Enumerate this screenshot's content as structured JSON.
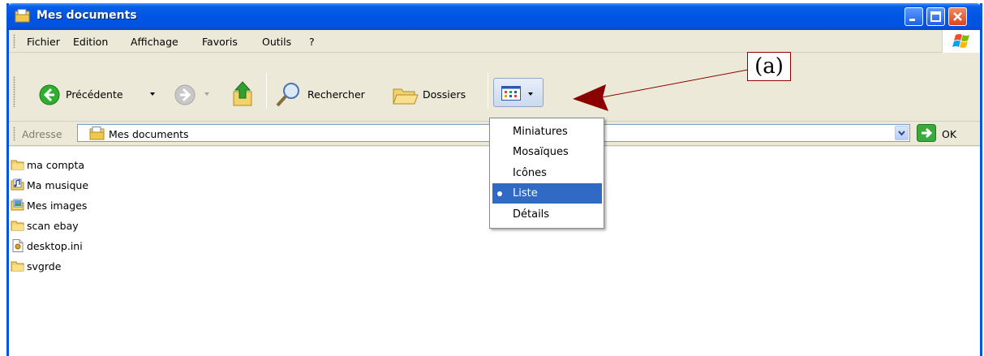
{
  "window": {
    "title": "Mes documents"
  },
  "menubar": {
    "items": [
      "Fichier",
      "Edition",
      "Affichage",
      "Favoris",
      "Outils",
      "?"
    ]
  },
  "toolbar": {
    "back_label": "Précédente",
    "search_label": "Rechercher",
    "folders_label": "Dossiers"
  },
  "address": {
    "label": "Adresse",
    "value": "Mes documents",
    "go_label": "OK"
  },
  "files": [
    {
      "name": "ma compta",
      "icon": "folder-icon"
    },
    {
      "name": "Ma musique",
      "icon": "music-folder-icon"
    },
    {
      "name": "Mes images",
      "icon": "pictures-folder-icon"
    },
    {
      "name": "scan ebay",
      "icon": "folder-icon"
    },
    {
      "name": "desktop.ini",
      "icon": "ini-file-icon"
    },
    {
      "name": "svgrde",
      "icon": "folder-icon"
    }
  ],
  "views_menu": {
    "items": [
      "Miniatures",
      "Mosaïques",
      "Icônes",
      "Liste",
      "Détails"
    ],
    "selected": "Liste"
  },
  "annotation": {
    "label": "(a)",
    "color": "#8b0000"
  },
  "colors": {
    "titlebar": "#0055e5",
    "menu_highlight": "#316ac5",
    "chrome": "#ece9d8"
  }
}
